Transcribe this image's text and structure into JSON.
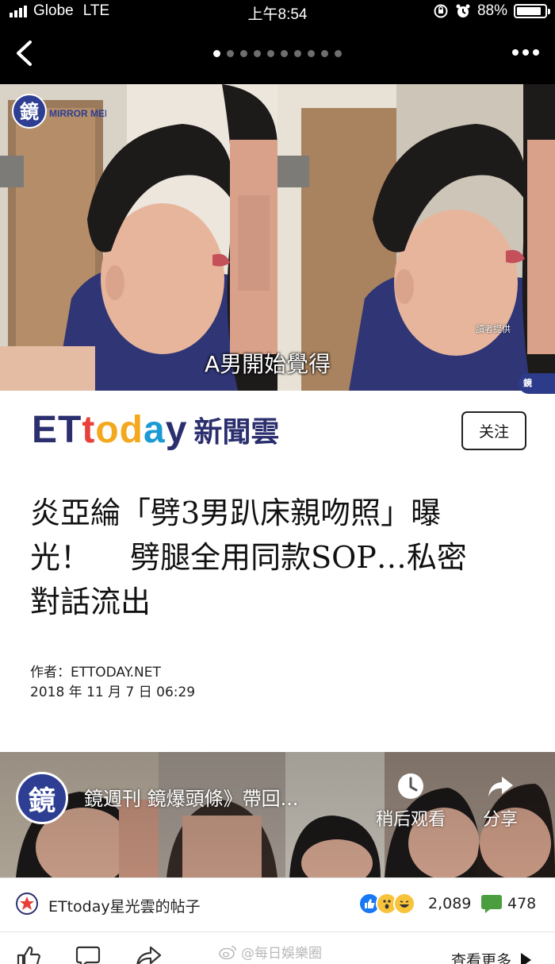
{
  "status_bar": {
    "carrier": "Globe",
    "network": "LTE",
    "time": "上午8:54",
    "battery": "88%",
    "battery_level": 0.88
  },
  "nav": {
    "page_count": 10,
    "active_page": 1
  },
  "photo": {
    "caption": "A男開始覺得",
    "reader_credit": "讀者提供",
    "logo_text": "MIRROR MEDIA",
    "logo_char": "鏡"
  },
  "article": {
    "brand_latin": "ETtoday",
    "brand_cn": "新聞雲",
    "follow_label": "关注",
    "headline_lines": [
      "炎亞綸「劈3男趴床親吻照」曝",
      "光！　 劈腿全用同款SOP…私密",
      "對話流出"
    ],
    "author": "作者：ETTODAY.NET",
    "date": "2018 年 11 月 7 日 06:29"
  },
  "video": {
    "channel_char": "鏡",
    "title": "鏡週刊 鏡爆頭條》帶回...",
    "watch_later": "稍后观看",
    "share": "分享"
  },
  "source": {
    "name": "ETtoday星光雲的帖子",
    "reaction_count": "2,089",
    "comment_count": "478"
  },
  "bottom": {
    "watermark": "@每日娛樂圈",
    "see_more": "查看更多"
  },
  "colors": {
    "brand_navy": "#2b2f6e",
    "brand_red": "#e8413b",
    "brand_orange": "#f4a81d",
    "brand_blue": "#1c9ad6",
    "fb_blue": "#1877f2",
    "comment_green": "#4a9e3f"
  }
}
